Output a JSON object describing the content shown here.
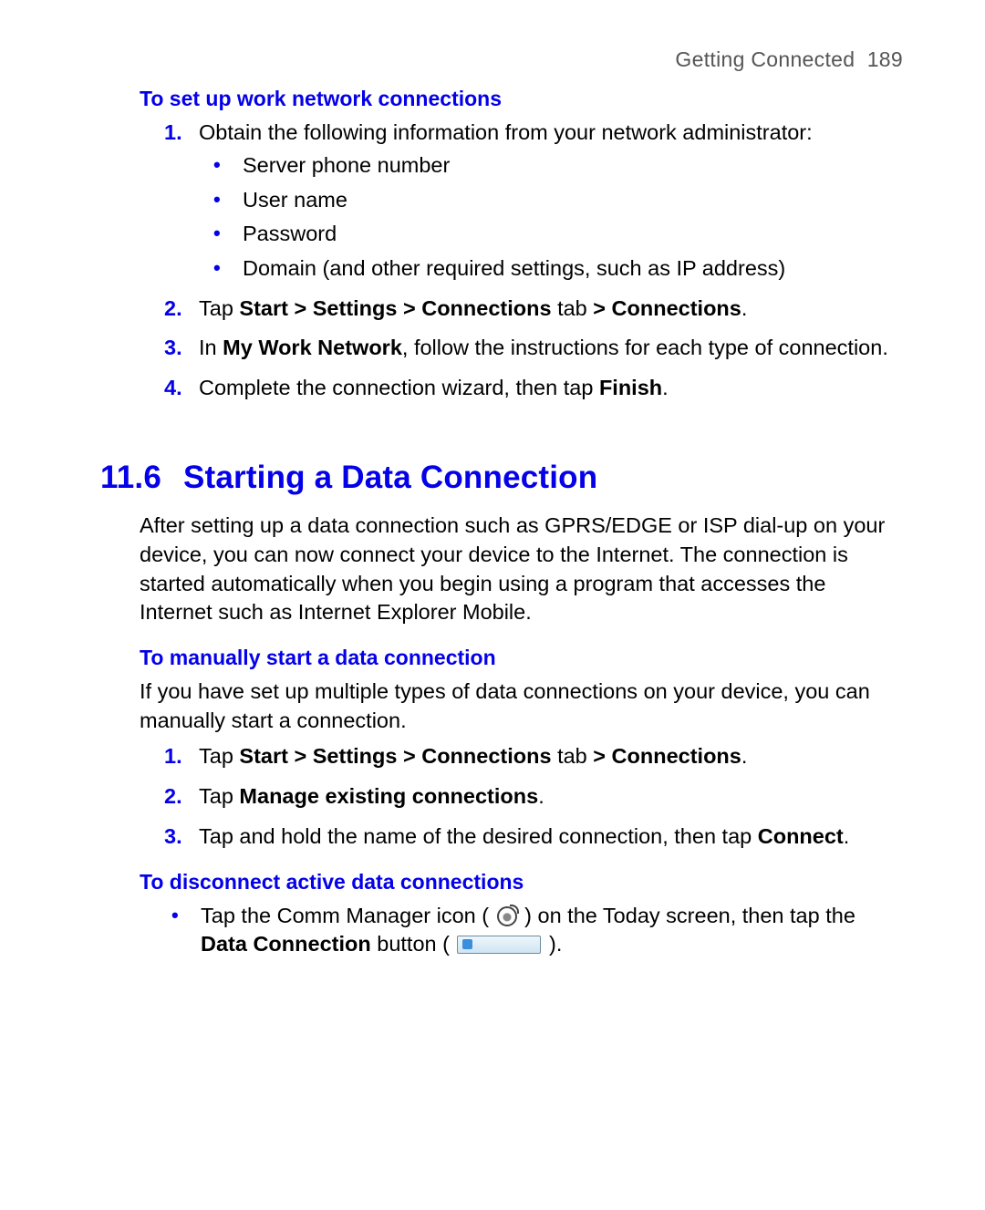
{
  "header": {
    "chapter": "Getting Connected",
    "page": "189"
  },
  "sub1": {
    "title": "To set up work network connections",
    "steps": [
      {
        "num": "1.",
        "segments": [
          {
            "text": "Obtain the following information from your network administrator:"
          }
        ],
        "bullets": [
          "Server phone number",
          "User name",
          "Password",
          "Domain (and other required settings, such as IP address)"
        ]
      },
      {
        "num": "2.",
        "segments": [
          {
            "text": "Tap "
          },
          {
            "text": "Start > Settings > Connections",
            "bold": true
          },
          {
            "text": " tab "
          },
          {
            "text": "> Connections",
            "bold": true
          },
          {
            "text": "."
          }
        ]
      },
      {
        "num": "3.",
        "segments": [
          {
            "text": "In "
          },
          {
            "text": "My Work Network",
            "bold": true
          },
          {
            "text": ", follow the instructions for each type of connection."
          }
        ]
      },
      {
        "num": "4.",
        "segments": [
          {
            "text": "Complete the connection wizard, then tap "
          },
          {
            "text": "Finish",
            "bold": true
          },
          {
            "text": "."
          }
        ]
      }
    ]
  },
  "section": {
    "number": "11.6",
    "title": "Starting a Data Connection",
    "intro": "After setting up a data connection such as GPRS/EDGE or ISP dial-up on your device, you can now connect your device to the Internet. The connection is started automatically when you begin using a program that accesses the Internet such as Internet Explorer Mobile."
  },
  "sub2": {
    "title": "To manually start a data connection",
    "intro": "If you have set up multiple types of data connections on your device, you can manually start a connection.",
    "steps": [
      {
        "num": "1.",
        "segments": [
          {
            "text": "Tap "
          },
          {
            "text": "Start > Settings > Connections",
            "bold": true
          },
          {
            "text": " tab "
          },
          {
            "text": "> Connections",
            "bold": true
          },
          {
            "text": "."
          }
        ]
      },
      {
        "num": "2.",
        "segments": [
          {
            "text": "Tap "
          },
          {
            "text": "Manage existing connections",
            "bold": true
          },
          {
            "text": "."
          }
        ]
      },
      {
        "num": "3.",
        "segments": [
          {
            "text": "Tap and hold the name of the desired connection, then tap "
          },
          {
            "text": "Connect",
            "bold": true
          },
          {
            "text": "."
          }
        ]
      }
    ]
  },
  "sub3": {
    "title": "To disconnect active data connections",
    "bullets": [
      {
        "segments": [
          {
            "text": "Tap the Comm Manager icon ( "
          },
          {
            "icon": "comm-manager-icon"
          },
          {
            "text": " ) on the Today screen, then tap the "
          },
          {
            "text": "Data Connection",
            "bold": true
          },
          {
            "text": " button ( "
          },
          {
            "icon": "data-connection-button-icon"
          },
          {
            "text": " )."
          }
        ]
      }
    ]
  }
}
